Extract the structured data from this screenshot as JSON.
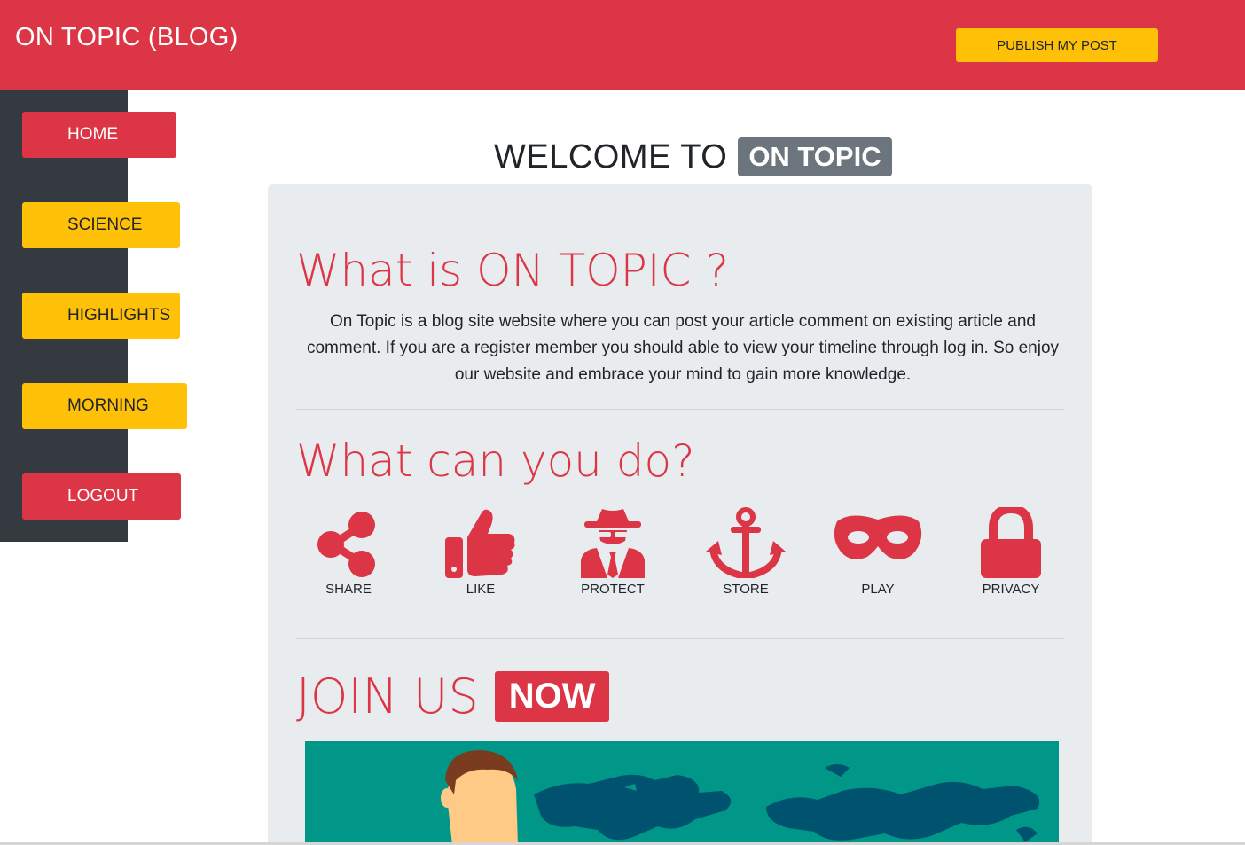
{
  "header": {
    "brand": "ON TOPIC (BLOG)",
    "publish_label": "PUBLISH MY POST"
  },
  "sidebar": {
    "items": [
      {
        "label": "HOME",
        "color": "#dc3545"
      },
      {
        "label": "SCIENCE",
        "color": "#ffc107"
      },
      {
        "label": "HIGHLIGHTS",
        "color": "#ffc107"
      },
      {
        "label": "MORNING",
        "color": "#ffc107"
      },
      {
        "label": "LOGOUT",
        "color": "#dc3545"
      }
    ]
  },
  "welcome": {
    "text": "WELCOME TO",
    "badge": "ON TOPIC"
  },
  "about": {
    "heading": "What is ON TOPIC ?",
    "body": "On Topic is a blog site website where you can post your article comment on existing article and comment. If you are a register member you should able to view your timeline through log in. So enjoy our website and embrace your mind to gain more knowledge."
  },
  "features": {
    "heading": "What can you do?",
    "items": [
      {
        "label": "SHARE",
        "icon": "share-icon"
      },
      {
        "label": "LIKE",
        "icon": "thumbs-up-icon"
      },
      {
        "label": "PROTECT",
        "icon": "spy-icon"
      },
      {
        "label": "STORE",
        "icon": "anchor-icon"
      },
      {
        "label": "PLAY",
        "icon": "mask-icon"
      },
      {
        "label": "PRIVACY",
        "icon": "lock-icon"
      }
    ]
  },
  "join": {
    "text": "JOIN US",
    "badge": "NOW"
  },
  "colors": {
    "primary_red": "#dc3545",
    "warning_yellow": "#ffc107",
    "dark": "#343a40",
    "badge_gray": "#6c757d",
    "card_bg": "#e9ecef",
    "banner_teal": "#009688"
  }
}
